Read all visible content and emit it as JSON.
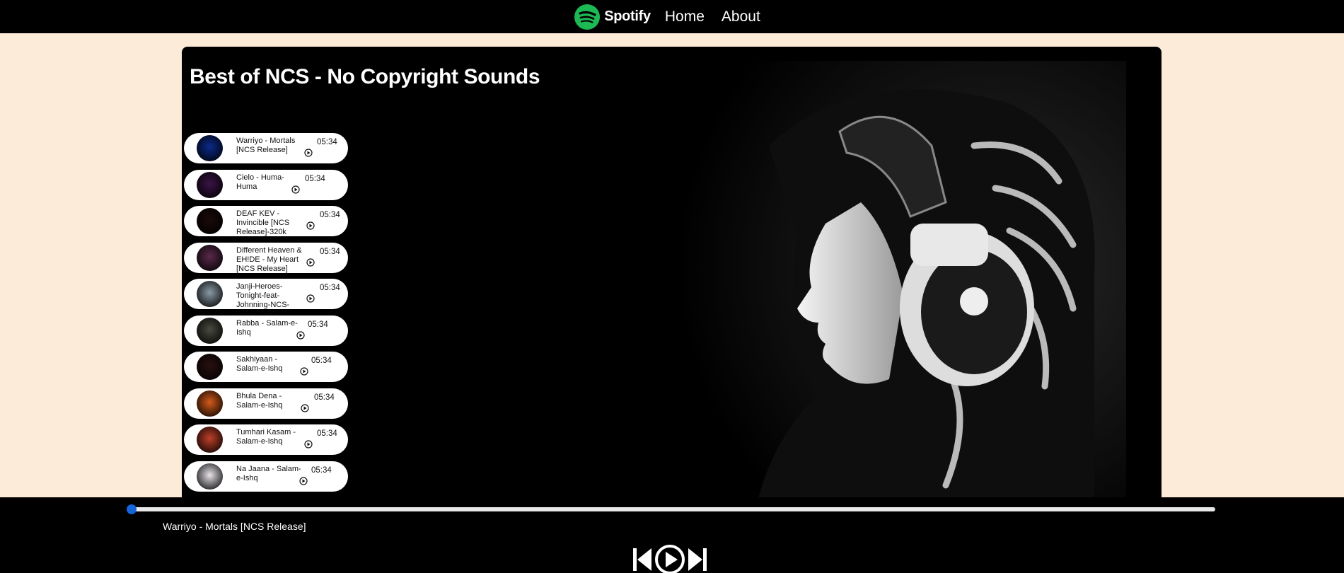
{
  "nav": {
    "brand": "Spotify",
    "links": [
      "Home",
      "About"
    ],
    "logo_color": "#1db954"
  },
  "playlist": {
    "title": "Best of NCS - No Copyright Sounds"
  },
  "songs": [
    {
      "name": "Warriyo - Mortals [NCS Release]",
      "duration": "05:34",
      "thumb_color": "#0b2a8a"
    },
    {
      "name": "Cielo - Huma-Huma",
      "duration": "05:34",
      "thumb_color": "#3a1446"
    },
    {
      "name": "DEAF KEV - Invincible [NCS Release]-320k",
      "duration": "05:34",
      "thumb_color": "#1a0a0a"
    },
    {
      "name": "Different Heaven & EH!DE - My Heart [NCS Release]",
      "duration": "05:34",
      "thumb_color": "#5a2a4a"
    },
    {
      "name": "Janji-Heroes-Tonight-feat-Johnning-NCS-Release",
      "duration": "05:34",
      "thumb_color": "#8a9aa6"
    },
    {
      "name": "Rabba - Salam-e-Ishq",
      "duration": "05:34",
      "thumb_color": "#4a4a40"
    },
    {
      "name": "Sakhiyaan - Salam-e-Ishq",
      "duration": "05:34",
      "thumb_color": "#2a1010"
    },
    {
      "name": "Bhula Dena - Salam-e-Ishq",
      "duration": "05:34",
      "thumb_color": "#d45a1a"
    },
    {
      "name": "Tumhari Kasam - Salam-e-Ishq",
      "duration": "05:34",
      "thumb_color": "#c0402a"
    },
    {
      "name": "Na Jaana - Salam-e-Ishq",
      "duration": "05:34",
      "thumb_color": "#e8e4ea"
    }
  ],
  "player": {
    "now_playing": "Warriyo - Mortals [NCS Release]",
    "progress": 0.0,
    "accent": "#1565d8"
  }
}
